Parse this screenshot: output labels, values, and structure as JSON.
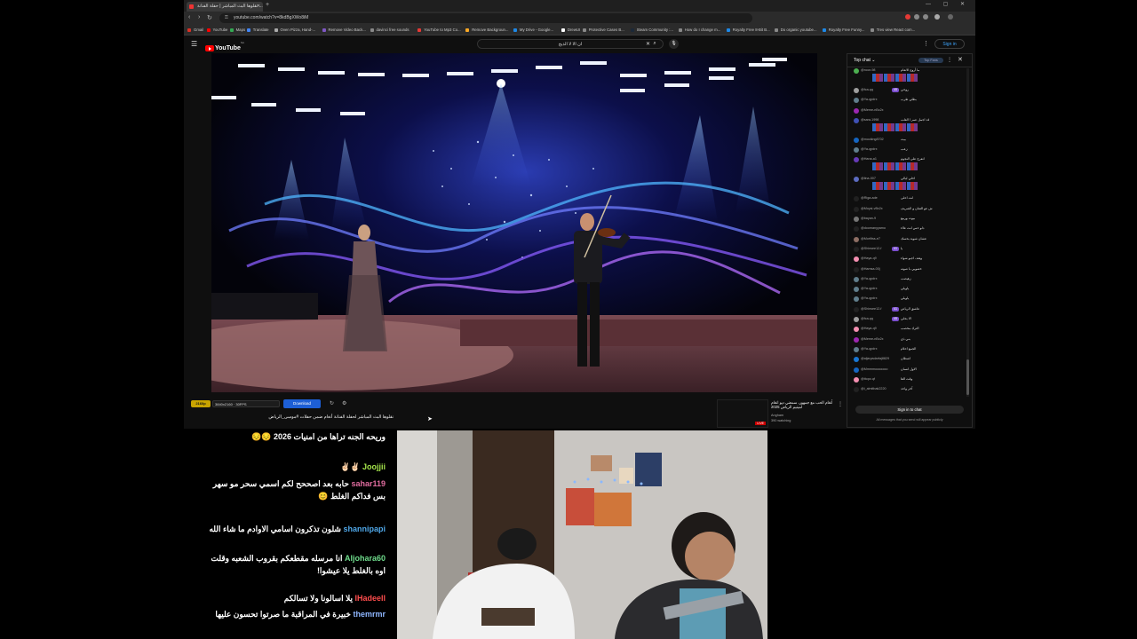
{
  "browser": {
    "tab_title": "نقلوها البث المباشر | حفلة الفنانة ...",
    "url": "youtube.com/watch?v=8kdBgXWo8iM",
    "bookmarks": [
      {
        "label": "Gmail",
        "color": "#d93025"
      },
      {
        "label": "YouTube",
        "color": "#ff0000"
      },
      {
        "label": "Maps",
        "color": "#34a853"
      },
      {
        "label": "Translate",
        "color": "#4285f4"
      },
      {
        "label": "Oven Pizza, Hand-...",
        "color": "#aaaaaa"
      },
      {
        "label": "Remove Video Back...",
        "color": "#7e57c2"
      },
      {
        "label": "davinci free sounds",
        "color": "#888888"
      },
      {
        "label": "YouTube to Mp3 Co...",
        "color": "#e53935"
      },
      {
        "label": "Remove Backgroun...",
        "color": "#f9a825"
      },
      {
        "label": "My Drive - Google...",
        "color": "#1e88e5"
      },
      {
        "label": "DrewUI",
        "color": "#ffffff"
      },
      {
        "label": "Protective Cases B...",
        "color": "#888888"
      },
      {
        "label": "Steam Community :...",
        "color": "#1b2838"
      },
      {
        "label": "How do I change m...",
        "color": "#888888"
      },
      {
        "label": "Royalty Free 8-Bit B...",
        "color": "#1e88e5"
      },
      {
        "label": "Do organic youtube...",
        "color": "#888888"
      },
      {
        "label": "Royalty Free Funny...",
        "color": "#1e88e5"
      },
      {
        "label": "Tres view React com...",
        "color": "#888888"
      }
    ]
  },
  "youtube": {
    "logo_text": "YouTube",
    "country": "SA",
    "search_query": "ان الا لا الذيح",
    "signin_label": "Sign in"
  },
  "download_bar": {
    "quality_badge": "2160p",
    "resolution": "3840x2160 · 30FPS",
    "download_label": "Download"
  },
  "video": {
    "title": "نقلوها البث المباشر لحفلة الفنانة أنغام ضمن حفلات #موسى_الرياض"
  },
  "related": {
    "title": "أنغام الحب مع جمهور، سمعني ديو انغام لمينيم الرياض 2025",
    "channel": "Angham",
    "watching": "390 watching",
    "live_badge": "LIVE"
  },
  "live_chat": {
    "header": "Top chat",
    "top_fans": "Top Fans",
    "signin_label": "Sign in to chat",
    "note": "All messages that you send will appear publicly",
    "messages": [
      {
        "user": "@noor-98",
        "text": "ما أروع الانغام",
        "color": "#4caf50",
        "big": true
      },
      {
        "user": "@fca-qq",
        "text": "روحي",
        "color": "#9e9e9e",
        "badge": "45"
      },
      {
        "user": "@Ya-qpdrx",
        "text": "بطلي طرب",
        "color": "#607d8b"
      },
      {
        "user": "@Meme-nBc2x",
        "text": "",
        "color": "#9c27b0"
      },
      {
        "user": "@sara-1998",
        "text": "قد اجمل عمر ا القلب",
        "color": "#3f51b5",
        "big": true
      },
      {
        "user": "@mocking8702",
        "text": "بيت",
        "color": "#1565c0"
      },
      {
        "user": "@Ya-qpdrx",
        "text": "زعب",
        "color": "#607d8b"
      },
      {
        "user": "@Hana-a1",
        "text": "اتفرج على النجوم",
        "color": "#673ab7",
        "big": true
      },
      {
        "user": "@lina-007",
        "text": "احلي ليالي",
        "color": "#5c6bc0",
        "big": true
      },
      {
        "user": "@Riga-ade",
        "text": "انت احلى",
        "color": "#212121"
      },
      {
        "user": "@Moysi-vBx2x",
        "text": "ش عو الفنان و الشريف",
        "color": "#212121"
      },
      {
        "user": "@bayan-9",
        "text": "بيوت وربيع",
        "color": "#757575"
      },
      {
        "user": "@doomanyyamo",
        "text": "دلو حس انت عااء",
        "color": "#212121"
      },
      {
        "user": "@Morfitss-e7",
        "text": "عشان شوية بحسك",
        "color": "#8d6e63"
      },
      {
        "user": "@Shinsee12-f",
        "text": "يا",
        "color": "#212121",
        "badge": "41"
      },
      {
        "user": "@Haya-q9",
        "text": "وهند، اجبو شواء",
        "color": "#f48fb1"
      },
      {
        "user": "@Hamsa-00j",
        "text": "خصويي با صوته",
        "color": "#212121"
      },
      {
        "user": "@Ya-qpdrx",
        "text": "زهيصب",
        "color": "#607d8b"
      },
      {
        "user": "@Ya-qpdrx",
        "text": "ياويلي",
        "color": "#607d8b"
      },
      {
        "user": "@Ya-qpdrx",
        "text": "ياويلي",
        "color": "#607d8b"
      },
      {
        "user": "@Shinsee12-f",
        "text": "عاشق الرياض",
        "color": "#212121",
        "badge": "41"
      },
      {
        "user": "@fca-qq",
        "text": "الا بحلي",
        "color": "#9e9e9e",
        "badge": "45"
      },
      {
        "user": "@Haya-q9",
        "text": "الترك مخصب",
        "color": "#f48fb1"
      },
      {
        "user": "@Meme-nBc2x",
        "text": "بني ذي",
        "color": "#9c27b0"
      },
      {
        "user": "@Ya-qpdrx",
        "text": "الجمع احلام",
        "color": "#607d8b"
      },
      {
        "user": "@aljaryadarfaj8829",
        "text": "اشطان",
        "color": "#1976d2"
      },
      {
        "user": "@Mmmmooooooo",
        "text": "الاول انسان",
        "color": "#1565c0"
      },
      {
        "user": "@ttopz-qf",
        "text": "وقت الغا",
        "color": "#f48fb1"
      },
      {
        "user": "@i_almitbak2220",
        "text": "آخر واحد",
        "color": "#212121"
      }
    ]
  },
  "overlay_chat": [
    {
      "user": "",
      "user_color": "#ffffff",
      "text": "وريحه الجنه تراها من امنيات 2026 😔😔"
    },
    {
      "user": "Joojjii",
      "user_color": "#a4e34a",
      "text": "✌🏻✌🏻"
    },
    {
      "user": "sahar119",
      "user_color": "#e06c9f",
      "text": "حابه بعد اصححح لكم اسمي سحر مو سهر بس فداكم الغلط 😊"
    },
    {
      "user": "shannipapi",
      "user_color": "#4fa7e8",
      "text": "شلون تذكرون اسامي الاوادم ما شاء الله"
    },
    {
      "user": "Aljohara60",
      "user_color": "#6fdc8c",
      "text": "انا مرسله مقطعكم بقروب الشعبه وقلت اوه بالغلط يلا عيشوا!"
    },
    {
      "user": "IHadeell",
      "user_color": "#ff4d4d",
      "text": "يلا اسالونا ولا تسالكم"
    },
    {
      "user": "themrmr",
      "user_color": "#8fb7ff",
      "text": "خبيرة في المراقبة ما صرتوا تحسون عليها"
    }
  ]
}
